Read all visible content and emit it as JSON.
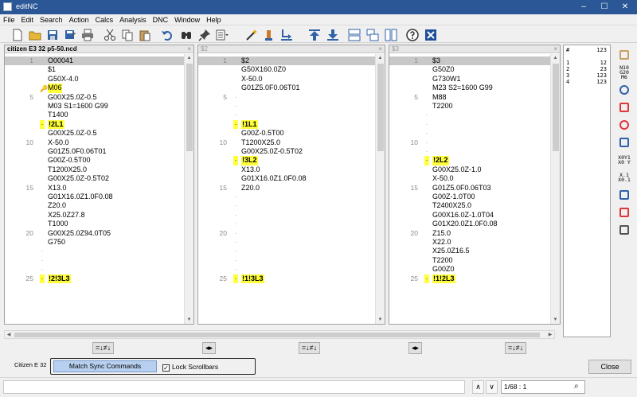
{
  "window": {
    "title": "editNC",
    "minimize": "–",
    "maximize": "☐",
    "close": "✕"
  },
  "menu": [
    "File",
    "Edit",
    "Search",
    "Action",
    "Calcs",
    "Analysis",
    "DNC",
    "Window",
    "Help"
  ],
  "toolbar": {
    "icons": [
      "new-file-icon",
      "open-folder-icon",
      "save-icon",
      "save-as-icon",
      "print-icon",
      "cut-icon",
      "copy-icon",
      "paste-icon",
      "undo-icon",
      "find-icon",
      "pin-icon",
      "list-dropdown-icon",
      "magic-wand-icon",
      "renumber-icon",
      "insert-icon",
      "arrow-up-icon",
      "arrow-down-icon",
      "tile-horizontal-icon",
      "tile-split-icon",
      "tile-vertical-icon",
      "help-icon",
      "exit-icon"
    ]
  },
  "panels": [
    {
      "title": "citizen E3 32 p5-50.ncd",
      "close": "×",
      "lines": [
        {
          "n": "1",
          "text": "O00041",
          "hl": true
        },
        {
          "n": "",
          "text": "$1"
        },
        {
          "n": "",
          "text": "G50X-4.0"
        },
        {
          "n": "",
          "text": "M06",
          "m06": true
        },
        {
          "n": "5",
          "text": "G00X25.0Z-0.5"
        },
        {
          "n": "",
          "text": "M03 S1=1600 G99"
        },
        {
          "n": "",
          "text": "T1400"
        },
        {
          "n": "",
          "text": "!2L1",
          "tag": true
        },
        {
          "n": "",
          "text": "G00X25.0Z-0.5"
        },
        {
          "n": "10",
          "text": "X-50.0"
        },
        {
          "n": "",
          "text": "G01Z5.0F0.06T01"
        },
        {
          "n": "",
          "text": "G00Z-0.5T00"
        },
        {
          "n": "",
          "text": "T1200X25.0"
        },
        {
          "n": "",
          "text": "G00X25.0Z-0.5T02"
        },
        {
          "n": "15",
          "text": "X13.0"
        },
        {
          "n": "",
          "text": "G01X16.0Z1.0F0.08"
        },
        {
          "n": "",
          "text": "Z20.0"
        },
        {
          "n": "",
          "text": "X25.0Z27.8"
        },
        {
          "n": "",
          "text": "T1000"
        },
        {
          "n": "20",
          "text": "G00X25.0Z94.0T05"
        },
        {
          "n": "",
          "text": "G750"
        },
        {
          "n": "",
          "text": ""
        },
        {
          "n": "",
          "text": ""
        },
        {
          "n": "",
          "text": ""
        },
        {
          "n": "25",
          "text": "!2!3L3",
          "tag": true
        }
      ]
    },
    {
      "title": "$2",
      "close": "×",
      "lines": [
        {
          "n": "1",
          "text": "$2",
          "hl": true
        },
        {
          "n": "",
          "text": "G50X160.0Z0"
        },
        {
          "n": "",
          "text": "X-50.0"
        },
        {
          "n": "",
          "text": "G01Z5.0F0.06T01"
        },
        {
          "n": "5",
          "text": ""
        },
        {
          "n": "",
          "text": ""
        },
        {
          "n": "",
          "text": ""
        },
        {
          "n": "",
          "text": "!1L1",
          "tag": true
        },
        {
          "n": "",
          "text": "G00Z-0.5T00"
        },
        {
          "n": "10",
          "text": "T1200X25.0"
        },
        {
          "n": "",
          "text": "G00X25.0Z-0.5T02"
        },
        {
          "n": "",
          "text": "!3L2",
          "tag": true
        },
        {
          "n": "",
          "text": "X13.0"
        },
        {
          "n": "",
          "text": "G01X16.0Z1.0F0.08"
        },
        {
          "n": "15",
          "text": "Z20.0"
        },
        {
          "n": "",
          "text": ""
        },
        {
          "n": "",
          "text": ""
        },
        {
          "n": "",
          "text": ""
        },
        {
          "n": "",
          "text": ""
        },
        {
          "n": "20",
          "text": ""
        },
        {
          "n": "",
          "text": ""
        },
        {
          "n": "",
          "text": ""
        },
        {
          "n": "",
          "text": ""
        },
        {
          "n": "",
          "text": ""
        },
        {
          "n": "25",
          "text": "!1!3L3",
          "tag": true
        }
      ]
    },
    {
      "title": "$3",
      "close": "×",
      "lines": [
        {
          "n": "1",
          "text": "$3",
          "hl": true
        },
        {
          "n": "",
          "text": "G50Z0"
        },
        {
          "n": "",
          "text": "G730W1"
        },
        {
          "n": "",
          "text": "M23 S2=1600 G99"
        },
        {
          "n": "5",
          "text": "M88"
        },
        {
          "n": "",
          "text": "T2200"
        },
        {
          "n": "",
          "text": ""
        },
        {
          "n": "",
          "text": ""
        },
        {
          "n": "",
          "text": ""
        },
        {
          "n": "10",
          "text": ""
        },
        {
          "n": "",
          "text": ""
        },
        {
          "n": "",
          "text": "!2L2",
          "tag": true
        },
        {
          "n": "",
          "text": "G00X25.0Z-1.0"
        },
        {
          "n": "",
          "text": "X-50.0"
        },
        {
          "n": "15",
          "text": "G01Z5.0F0.06T03"
        },
        {
          "n": "",
          "text": "G00Z-1.0T00"
        },
        {
          "n": "",
          "text": "T2400X25.0"
        },
        {
          "n": "",
          "text": "G00X16.0Z-1.0T04"
        },
        {
          "n": "",
          "text": "G01X20.0Z1.0F0.08"
        },
        {
          "n": "20",
          "text": "Z15.0"
        },
        {
          "n": "",
          "text": "X22.0"
        },
        {
          "n": "",
          "text": "X25.0Z16.5"
        },
        {
          "n": "",
          "text": "T2200"
        },
        {
          "n": "",
          "text": "G00Z0"
        },
        {
          "n": "25",
          "text": "!1!2L3",
          "tag": true
        }
      ]
    }
  ],
  "sync_buttons": {
    "compare": "=↓≠↓",
    "link": "◂▸"
  },
  "bottom": {
    "machine": "Citizen E 32",
    "match_sync": "Match Sync Commands",
    "lock_scrollbars": "Lock Scrollbars",
    "lock_checked": "✓",
    "close": "Close"
  },
  "status": {
    "position": "1/68 : 1",
    "nav_up": "∧",
    "nav_down": "∨"
  },
  "info": {
    "header": {
      "n": "#",
      "v": "123"
    },
    "rows": [
      {
        "n": "1",
        "v": "12"
      },
      {
        "n": "2",
        "v": "23"
      },
      {
        "n": "3",
        "v": "123"
      },
      {
        "n": "4",
        "v": "123"
      }
    ]
  },
  "right_tools": [
    {
      "icon": "folder-machine-icon",
      "label": ""
    },
    {
      "icon": "nc-codes-icon",
      "label": "N10\nG20\nM6"
    },
    {
      "icon": "tool-path-icon",
      "label": ""
    },
    {
      "icon": "points-icon",
      "label": ""
    },
    {
      "icon": "circle-points-icon",
      "label": ""
    },
    {
      "icon": "grid-points-icon",
      "label": ""
    },
    {
      "icon": "xyz-coords-icon",
      "label": "X0Y1\nX0 Y"
    },
    {
      "icon": "decimal-icon",
      "label": "X.1\nX0.1"
    },
    {
      "icon": "info-icon",
      "label": ""
    },
    {
      "icon": "ruler-icon",
      "label": ""
    },
    {
      "icon": "machine-icon",
      "label": ""
    }
  ]
}
